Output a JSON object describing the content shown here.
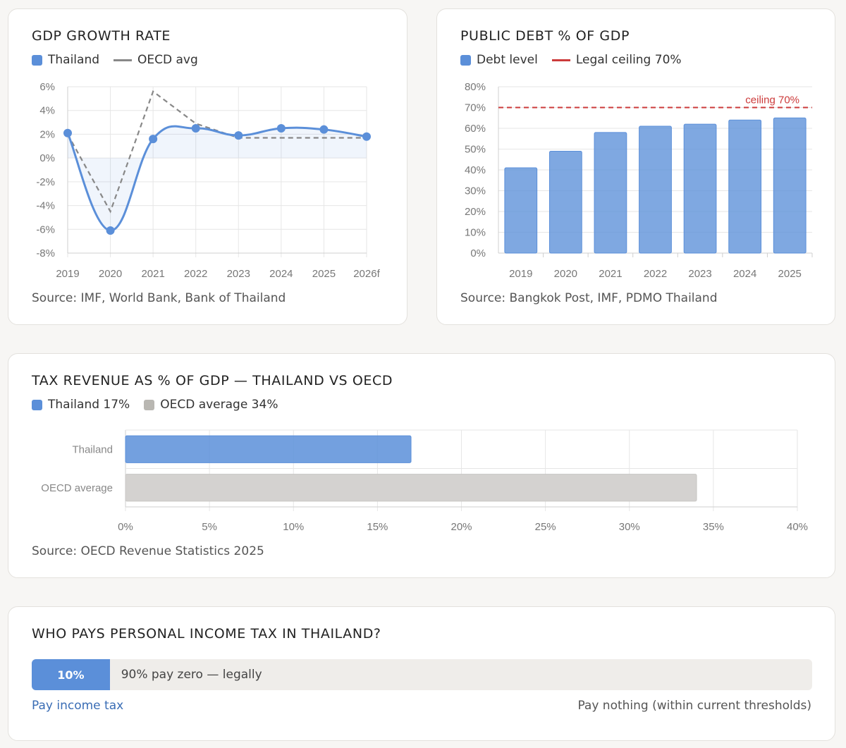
{
  "colors": {
    "primary": "#5b8fd9",
    "oecd_line": "#888888",
    "ceiling": "#cc3b3b",
    "oecd_bar": "#d4d2d0",
    "grid": "#e6e6e6"
  },
  "gdp": {
    "title": "GDP GROWTH RATE",
    "legend": [
      {
        "label": "Thailand",
        "kind": "swatch",
        "color": "#5b8fd9"
      },
      {
        "label": "OECD avg",
        "kind": "line",
        "color": "#888888"
      }
    ],
    "source": "Source: IMF, World Bank, Bank of Thailand"
  },
  "debt": {
    "title": "PUBLIC DEBT % OF GDP",
    "legend": [
      {
        "label": "Debt level",
        "kind": "swatch",
        "color": "#5b8fd9"
      },
      {
        "label": "Legal ceiling 70%",
        "kind": "redline",
        "color": "#cc3b3b"
      }
    ],
    "source": "Source: Bangkok Post, IMF, PDMO Thailand"
  },
  "tax": {
    "title": "TAX REVENUE AS % OF GDP — THAILAND VS OECD",
    "legend": [
      {
        "label": "Thailand 17%",
        "kind": "swatch",
        "color": "#5b8fd9"
      },
      {
        "label": "OECD average 34%",
        "kind": "swatch",
        "color": "#b9b7b2"
      }
    ],
    "source": "Source: OECD Revenue Statistics 2025"
  },
  "pit": {
    "title": "WHO PAYS PERSONAL INCOME TAX IN THAILAND?",
    "share": 10,
    "fill_label": "10%",
    "rest_label": "90% pay zero — legally",
    "left_label": "Pay income tax",
    "right_label": "Pay nothing (within current thresholds)"
  },
  "chart_data": [
    {
      "type": "line",
      "x": [
        "2019",
        "2020",
        "2021",
        "2022",
        "2023",
        "2024",
        "2025",
        "2026f"
      ],
      "series": [
        {
          "name": "Thailand",
          "values": [
            2.1,
            -6.1,
            1.6,
            2.5,
            1.9,
            2.5,
            2.4,
            1.8
          ]
        },
        {
          "name": "OECD avg",
          "values": [
            2.0,
            -4.5,
            5.6,
            2.9,
            1.7,
            1.7,
            1.7,
            1.7
          ]
        }
      ],
      "yticks": [
        "6%",
        "4%",
        "2%",
        "0%",
        "-2%",
        "-4%",
        "-6%",
        "-8%"
      ],
      "ylim": [
        -8,
        6
      ],
      "grid": true
    },
    {
      "type": "bar",
      "categories": [
        "2019",
        "2020",
        "2021",
        "2022",
        "2023",
        "2024",
        "2025"
      ],
      "values": [
        41,
        49,
        58,
        61,
        62,
        64,
        65
      ],
      "yticks": [
        "80%",
        "70%",
        "60%",
        "50%",
        "40%",
        "30%",
        "20%",
        "10%",
        "0%"
      ],
      "ylim": [
        0,
        80
      ],
      "reference_line": {
        "value": 70,
        "label": "ceiling 70%"
      },
      "grid": true
    },
    {
      "type": "bar",
      "orientation": "horizontal",
      "categories": [
        "Thailand",
        "OECD average"
      ],
      "values": [
        17,
        34
      ],
      "xticks": [
        "0%",
        "5%",
        "10%",
        "15%",
        "20%",
        "25%",
        "30%",
        "35%",
        "40%"
      ],
      "xlim": [
        0,
        40
      ],
      "grid": true
    }
  ]
}
